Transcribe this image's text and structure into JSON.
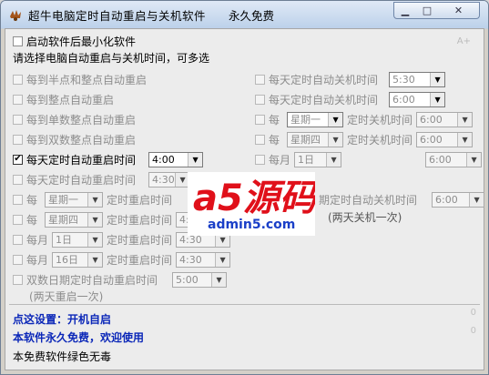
{
  "window": {
    "title": "超牛电脑定时自动重启与关机软件",
    "free_label": "永久免费",
    "btn_min": "▁",
    "btn_max": "□",
    "btn_close": "✕"
  },
  "top": {
    "minimize_after_start": "启动软件后最小化软件",
    "instruction": "请选择电脑自动重启与关机时间，可多选",
    "font_toggle": "A+"
  },
  "left": {
    "half_hour": "每到半点和整点自动重启",
    "whole_hour": "每到整点自动重启",
    "odd_hour": "每到单数整点自动重启",
    "even_hour": "每到双数整点自动重启",
    "daily1_label": "每天定时自动重启时间",
    "daily1_value": "4:00",
    "daily2_label": "每天定时自动重启时间",
    "daily2_value": "4:30",
    "week1_prefix": "每",
    "week1_day": "星期一",
    "week1_suffix": "定时重启时间",
    "week2_prefix": "每",
    "week2_day": "星期四",
    "week2_suffix": "定时重启时间",
    "week2_value": "4:30",
    "month1_prefix": "每月",
    "month1_day": "1日",
    "month1_suffix": "定时重启时间",
    "month1_value": "4:30",
    "month2_prefix": "每月",
    "month2_day": "16日",
    "month2_suffix": "定时重启时间",
    "month2_value": "4:30",
    "bidate_label": "双数日期定时自动重启时间",
    "bidate_value": "5:00",
    "bidate_note": "(两天重启一次)"
  },
  "right": {
    "daily1_label": "每天定时自动关机时间",
    "daily1_value": "5:30",
    "daily2_label": "每天定时自动关机时间",
    "daily2_value": "6:00",
    "week1_prefix": "每",
    "week1_day": "星期一",
    "week1_suffix": "定时关机时间",
    "week1_value": "6:00",
    "week2_prefix": "每",
    "week2_day": "星期四",
    "week2_suffix": "定时关机时间",
    "week2_value": "6:00",
    "month1_prefix": "每月",
    "month1_day": "1日",
    "month1_value": "6:00",
    "bi_suffix": "期定时自动关机时间",
    "bi_value": "6:00",
    "bi_note": "(两天关机一次)"
  },
  "bottom": {
    "setting_link": "点这设置：开机自启",
    "free_note": "本软件永久免费，欢迎使用",
    "green_note": "本免费软件绿色无毒",
    "counter1": "0",
    "counter2": "0"
  },
  "watermark": {
    "brand": "a5源码",
    "site": "admin5.com"
  },
  "colors": {
    "link_blue": "#0b27b8",
    "watermark_red": "#e0101a",
    "watermark_blue": "#1a3fc8"
  }
}
